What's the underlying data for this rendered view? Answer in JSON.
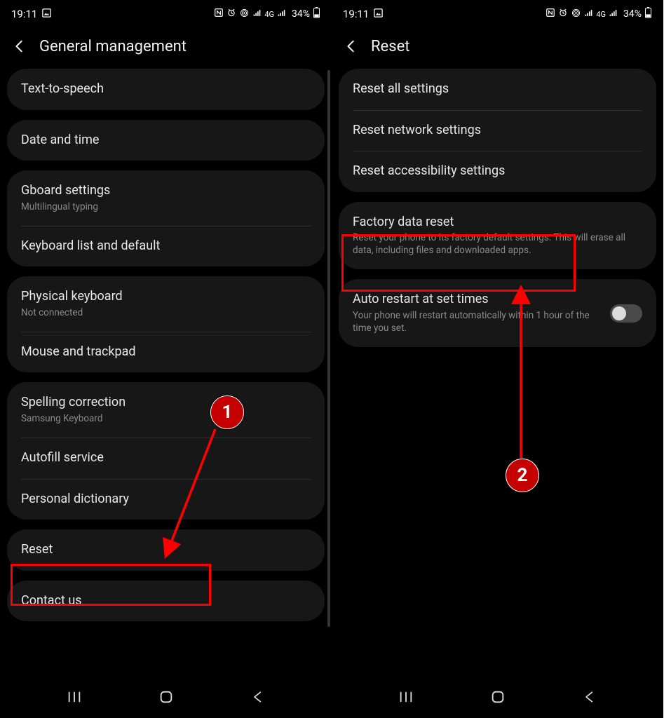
{
  "statusbar": {
    "time": "19:11",
    "battery_pct": "34%",
    "net_label": "4G"
  },
  "left": {
    "title": "General management",
    "groups": [
      {
        "rows": [
          {
            "title": "Text-to-speech"
          }
        ]
      },
      {
        "rows": [
          {
            "title": "Date and time"
          }
        ]
      },
      {
        "rows": [
          {
            "title": "Gboard settings",
            "sub": "Multilingual typing"
          },
          {
            "title": "Keyboard list and default"
          }
        ]
      },
      {
        "rows": [
          {
            "title": "Physical keyboard",
            "sub": "Not connected"
          },
          {
            "title": "Mouse and trackpad"
          }
        ]
      },
      {
        "rows": [
          {
            "title": "Spelling correction",
            "sub": "Samsung Keyboard"
          },
          {
            "title": "Autofill service"
          },
          {
            "title": "Personal dictionary"
          }
        ]
      },
      {
        "rows": [
          {
            "title": "Reset"
          }
        ]
      },
      {
        "rows": [
          {
            "title": "Contact us"
          }
        ]
      }
    ]
  },
  "right": {
    "title": "Reset",
    "groups": [
      {
        "rows": [
          {
            "title": "Reset all settings"
          },
          {
            "title": "Reset network settings"
          },
          {
            "title": "Reset accessibility settings"
          }
        ]
      },
      {
        "rows": [
          {
            "title": "Factory data reset",
            "sub": "Reset your phone to its factory default settings. This will erase all data, including files and downloaded apps."
          }
        ]
      },
      {
        "rows": [
          {
            "title": "Auto restart at set times",
            "sub": "Your phone will restart automatically within 1 hour of the time you set.",
            "toggle": false
          }
        ]
      }
    ]
  },
  "annotations": {
    "marker1": "1",
    "marker2": "2"
  }
}
